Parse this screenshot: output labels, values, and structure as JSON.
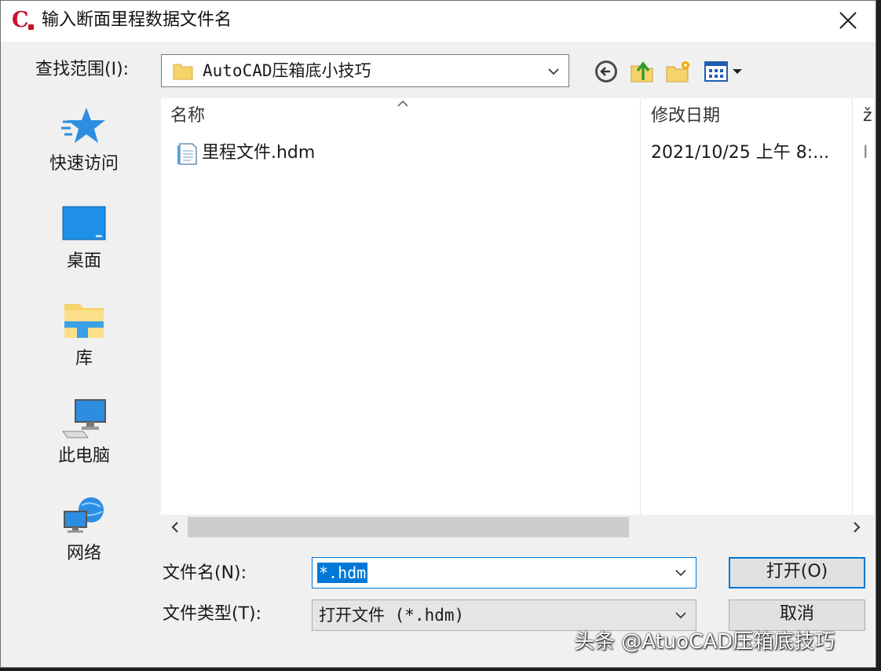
{
  "window": {
    "title": "输入断面里程数据文件名",
    "app_icon_letter": "C",
    "close_glyph": "×"
  },
  "lookin": {
    "label": "查找范围(I):",
    "value": "AutoCAD压箱底小技巧"
  },
  "toolbar": {
    "icons": [
      "back-icon",
      "up-folder-icon",
      "new-folder-icon",
      "view-menu-icon"
    ]
  },
  "places": [
    {
      "label": "快速访问",
      "icon": "quick-access-star-icon"
    },
    {
      "label": "桌面",
      "icon": "desktop-icon"
    },
    {
      "label": "库",
      "icon": "libraries-icon"
    },
    {
      "label": "此电脑",
      "icon": "this-pc-icon"
    },
    {
      "label": "网络",
      "icon": "network-icon"
    }
  ],
  "filelist": {
    "columns": [
      {
        "label": "名称"
      },
      {
        "label": "修改日期"
      },
      {
        "label": "ž"
      }
    ],
    "rows": [
      {
        "name": "里程文件.hdm",
        "date": "2021/10/25 上午 8:...",
        "extra": "I"
      }
    ]
  },
  "filename": {
    "label": "文件名(N):",
    "value": "*.hdm"
  },
  "filetype": {
    "label": "文件类型(T):",
    "value": "打开文件 (*.hdm)"
  },
  "buttons": {
    "open": "打开(O)",
    "cancel": "取消"
  },
  "watermark": "头条 @AtuoCAD压箱底技巧",
  "colors": {
    "accent": "#0078d7",
    "app_red": "#c8102e",
    "dialog_bg": "#f0f0f0"
  }
}
